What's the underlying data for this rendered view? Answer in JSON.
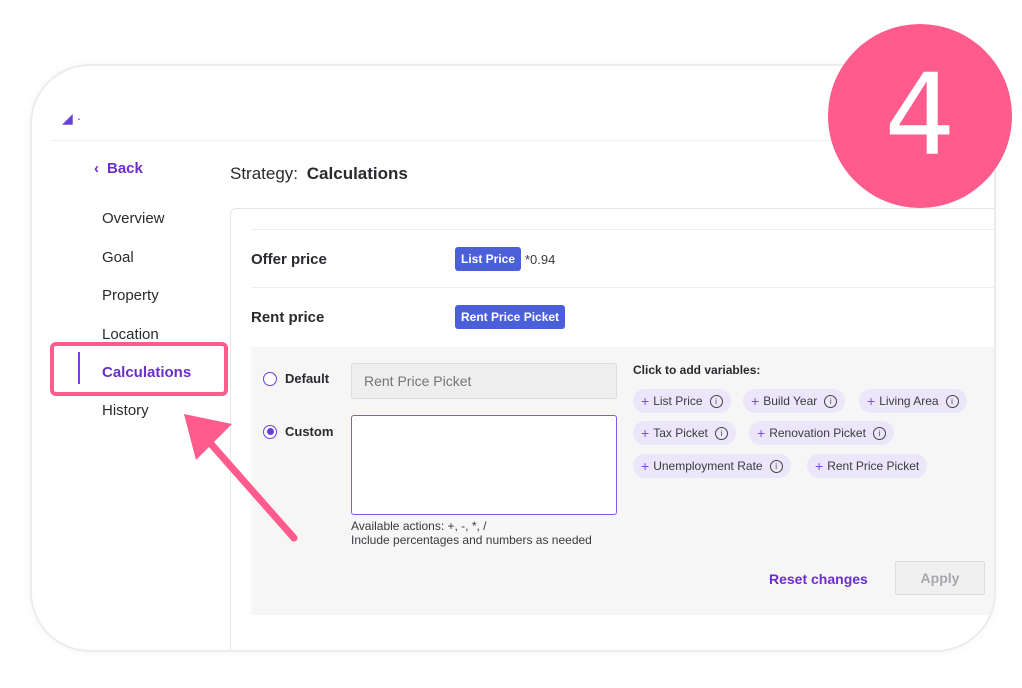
{
  "nav": {
    "back_label": "Back",
    "items": [
      "Overview",
      "Goal",
      "Property",
      "Location",
      "Calculations",
      "History"
    ],
    "active": "Calculations"
  },
  "page": {
    "title_prefix": "Strategy:",
    "title_value": "Calculations"
  },
  "offer_price": {
    "label": "Offer price",
    "variable_chip": "List Price",
    "expression": "*0.94"
  },
  "rent_price": {
    "label": "Rent price",
    "variable_chip": "Rent Price Picket"
  },
  "editor": {
    "default_label": "Default",
    "default_placeholder": "Rent Price Picket",
    "custom_label": "Custom",
    "custom_value": "",
    "hint_line1": "Available actions: +, -, *, /",
    "hint_line2": "Include percentages and numbers as needed",
    "variables_title": "Click to add variables:",
    "variables": [
      "List Price",
      "Build Year",
      "Living Area",
      "Tax Picket",
      "Renovation Picket",
      "Unemployment Rate",
      "Rent Price Picket"
    ],
    "reset_label": "Reset changes",
    "apply_label": "Apply"
  },
  "step_badge": "4",
  "colors": {
    "accent": "#6b2ecc",
    "chip_blue": "#4a5fd8",
    "highlight": "#ff5b8c",
    "variable_chip_bg": "#ece6fa"
  }
}
